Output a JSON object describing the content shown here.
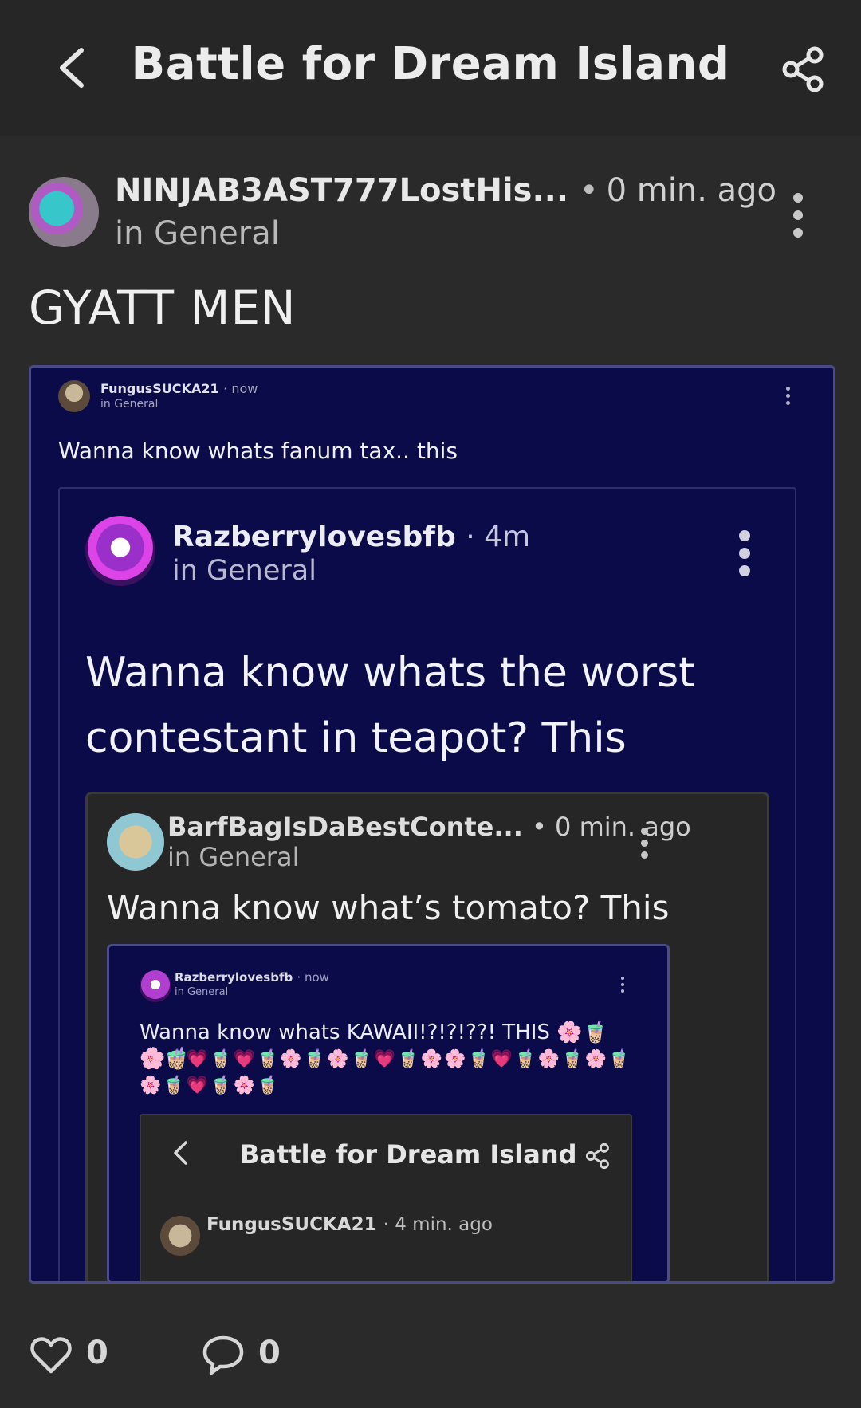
{
  "header": {
    "title": "Battle for Dream Island"
  },
  "post": {
    "author": "NINJAB3AST777LostHis...",
    "separator": "•",
    "time": "0 min. ago",
    "community": "in General",
    "text": "GYATT MEN"
  },
  "screenshot": {
    "post1": {
      "author": "FungusSUCKA21",
      "time": "· now",
      "community": "in General",
      "text": "Wanna know whats fanum tax.. this"
    },
    "post2": {
      "author": "Razberrylovesbfb",
      "time": "· 4m",
      "community": "in General",
      "text": "Wanna know whats the worst contestant in teapot? This"
    },
    "post3": {
      "author": "BarfBagIsDaBestConte...",
      "time": "• 0 min. ago",
      "community": "in General",
      "text": "Wanna know what’s tomato? This"
    },
    "post4": {
      "author": "Razberrylovesbfb",
      "time": "· now",
      "community": "in General",
      "text": "Wanna know whats KAWAII!?!?!??! THIS 🌸🧋🌸🧋",
      "emojis": "🌸🧋💗🧋💗🧋🌸🧋🌸🧋💗🧋🌸🌸🧋💗🧋🌸🧋🌸🧋🌸🧋💗🧋🌸🧋"
    },
    "post5": {
      "title": "Battle for Dream Island",
      "author": "FungusSUCKA21",
      "time": "· 4 min. ago"
    }
  },
  "footer": {
    "likes": "0",
    "comments": "0"
  },
  "icons": {
    "back": "chevron-left-icon",
    "share": "share-icon",
    "more": "more-vertical-icon",
    "like": "heart-icon",
    "comment": "comment-bubble-icon"
  }
}
